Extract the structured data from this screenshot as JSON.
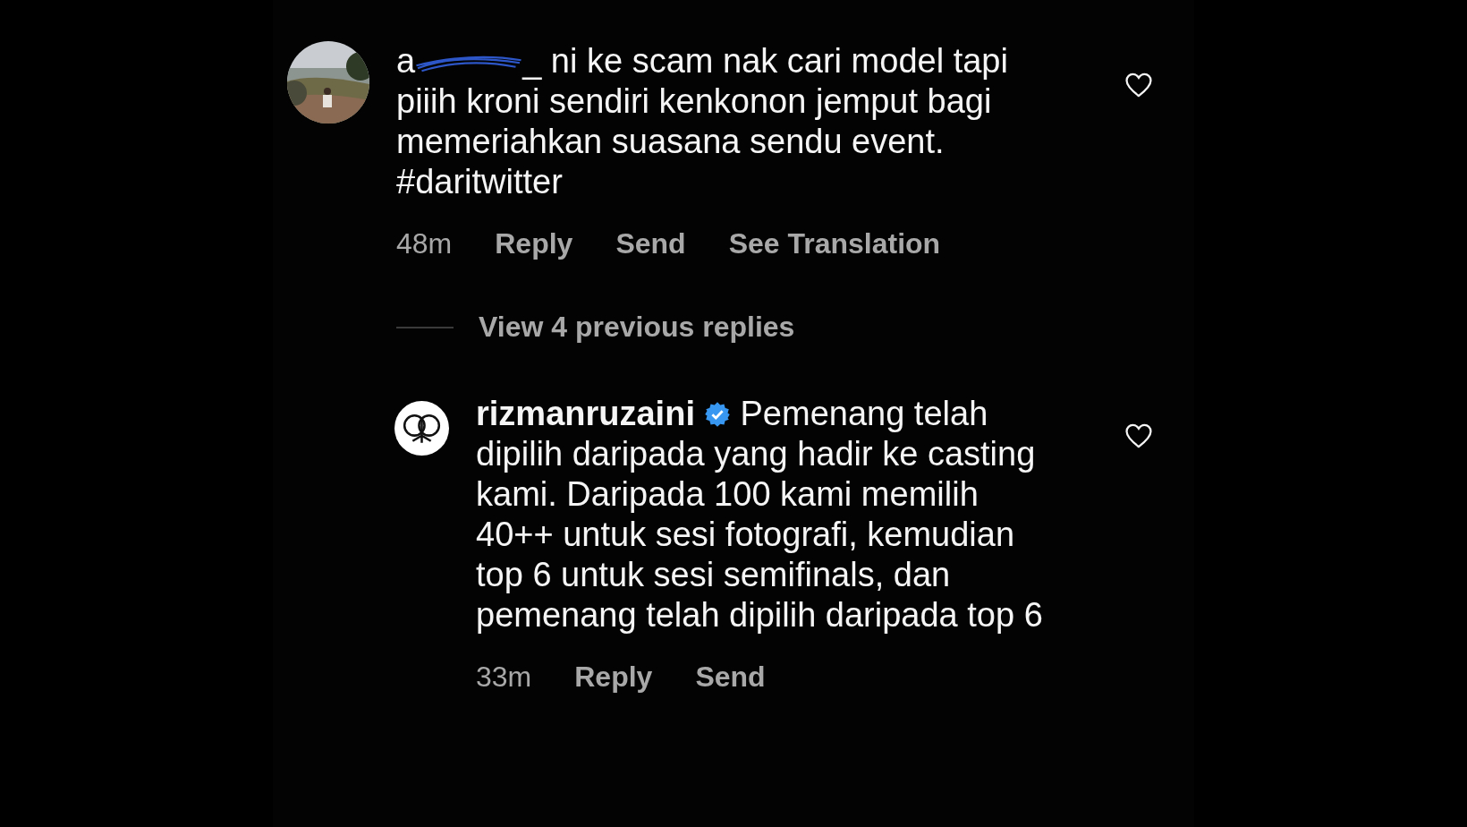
{
  "comments": [
    {
      "username_start": "a",
      "username_end": "_",
      "redacted": true,
      "verified": false,
      "text": "ni ke scam nak cari model tapi piiih kroni sendiri kenkonon jemput bagi memeriahkan suasana sendu event. #daritwitter",
      "time": "48m",
      "actions": [
        "Reply",
        "Send",
        "See Translation"
      ],
      "liked": false,
      "reply": false
    },
    {
      "view_replies": "View 4 previous replies"
    },
    {
      "username_start": "rizmanruzaini",
      "redacted": false,
      "verified": true,
      "avatar": {
        "kind": "logo"
      },
      "text": "Pemenang telah dipilih daripada yang hadir ke casting kami. Daripada 100 kami memilih 40++ untuk sesi fotografi, kemudian top 6 untuk sesi semifinals, dan pemenang telah dipilih daripada top 6",
      "time": "33m",
      "actions": [
        "Reply",
        "Send"
      ],
      "liked": false,
      "reply": true
    }
  ]
}
